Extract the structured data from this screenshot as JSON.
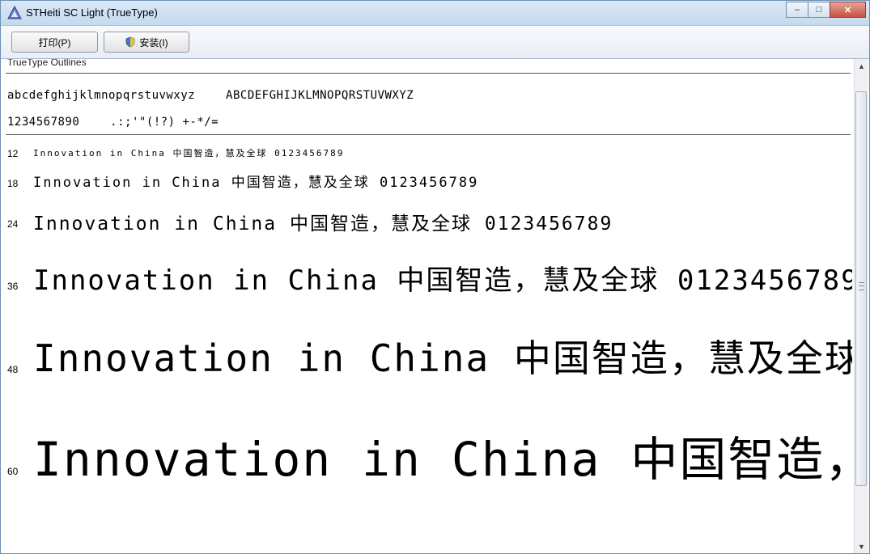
{
  "window": {
    "title": "STHeiti SC Light (TrueType)",
    "minimize": "–",
    "maximize": "□",
    "close": "✕"
  },
  "toolbar": {
    "print_label": "打印(P)",
    "install_label": "安装(I)"
  },
  "preview": {
    "header": "TrueType Outlines",
    "lowercase_line": "abcdefghijklmnopqrstuvwxyz",
    "uppercase_line": "ABCDEFGHIJKLMNOPQRSTUVWXYZ",
    "digits_line": "1234567890",
    "symbols_line": ".:;'\"(!?) +-*/=",
    "phrase": "Innovation in China",
    "cjk": "中国智造，慧及全球",
    "digits": "0123456789",
    "sizes": [
      "12",
      "18",
      "24",
      "36",
      "48",
      "60"
    ]
  },
  "colors": {
    "accent": "#c85242",
    "titlebar": "#c5d9ef"
  }
}
